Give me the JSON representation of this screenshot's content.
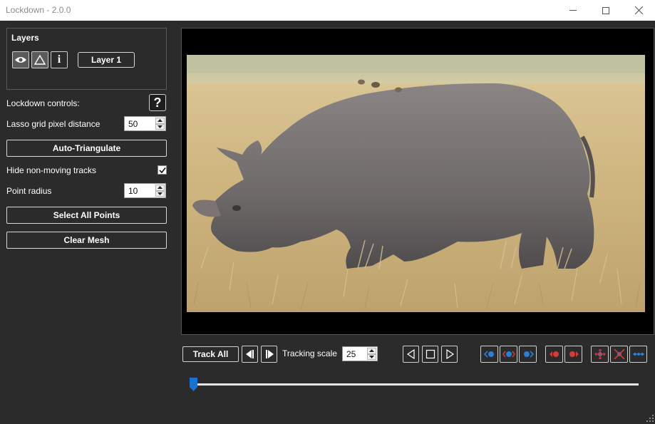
{
  "window": {
    "title": "Lockdown - 2.0.0"
  },
  "layers": {
    "heading": "Layers",
    "layer_name": "Layer 1",
    "info_glyph": "i"
  },
  "controls": {
    "lockdown_label": "Lockdown controls:",
    "help_glyph": "?",
    "lasso_label": "Lasso grid pixel distance",
    "lasso_value": "50",
    "auto_triangulate": "Auto-Triangulate",
    "hide_tracks_label": "Hide non-moving tracks",
    "hide_tracks_checked": true,
    "point_radius_label": "Point radius",
    "point_radius_value": "10",
    "select_all_points": "Select All Points",
    "clear_mesh": "Clear Mesh"
  },
  "transport": {
    "track_all": "Track All",
    "tracking_scale_label": "Tracking scale",
    "tracking_scale_value": "25"
  },
  "timeline": {
    "position_fraction": 0.0
  },
  "icons": [
    "eye-icon",
    "triangle-icon",
    "info-icon",
    "help-icon",
    "step-back-icon",
    "step-forward-icon",
    "play-back-icon",
    "stop-icon",
    "play-forward-icon",
    "keyframe-left-blue-icon",
    "keyframe-both-red-icon",
    "keyframe-right-blue-icon",
    "delete-left-red-icon",
    "delete-right-red-icon",
    "target-move-icon",
    "target-delete-icon",
    "target-slide-icon"
  ],
  "colors": {
    "background": "#2b2b2b",
    "accent_blue": "#2a7fd4",
    "accent_red": "#d63a3a",
    "slider_thumb": "#1a73d1"
  }
}
